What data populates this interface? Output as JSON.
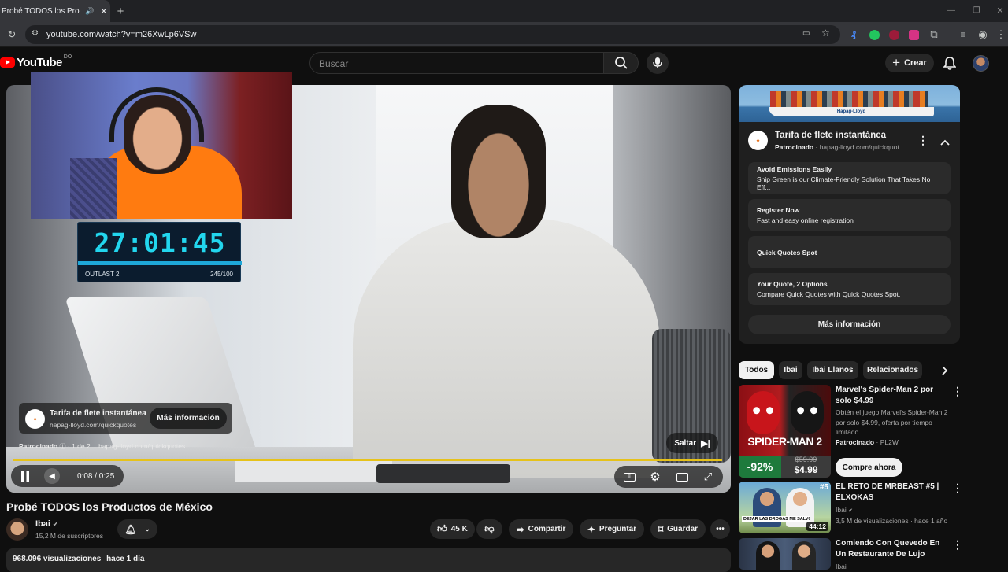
{
  "browser": {
    "tab_title": "Probé TODOS los Producto",
    "url": "youtube.com/watch?v=m26XwLp6VSw"
  },
  "youtube": {
    "logo_text": "YouTube",
    "country_code": "DO",
    "search_placeholder": "Buscar",
    "create_label": "Crear"
  },
  "overlay": {
    "timer": "27:01:45",
    "game": "OUTLAST 2",
    "count": "245/100"
  },
  "player": {
    "ad_title": "Tarifa de flete instantánea",
    "ad_domain": "hapag-lloyd.com/quickquotes",
    "ad_more": "Más información",
    "sponsored": "Patrocinado",
    "ad_counter": "· 1 de 2",
    "ad_domain2": "hapag-lloyd.com/quickquotes",
    "skip": "Saltar",
    "time": "0:08 / 0:25",
    "progress_fraction": 0.32
  },
  "video": {
    "title": "Probé TODOS los Productos de México",
    "channel": "Ibai",
    "subscribers": "15,2 M de suscriptores",
    "likes": "45 K",
    "share": "Compartir",
    "ask": "Preguntar",
    "save": "Guardar",
    "views": "968.096 visualizaciones",
    "age": "hace 1 día"
  },
  "ad_panel": {
    "ship_label": "Hapag-Lloyd",
    "title": "Tarifa de flete instantánea",
    "sponsored": "Patrocinado",
    "domain": "· hapag-lloyd.com/quickquot...",
    "options": [
      {
        "heading": "Avoid Emissions Easily",
        "text": "Ship Green is our Climate-Friendly Solution That Takes No Eff..."
      },
      {
        "heading": "Register Now",
        "text": "Fast and easy online registration"
      },
      {
        "heading": "Quick Quotes Spot",
        "text": ""
      },
      {
        "heading": "Your Quote, 2 Options",
        "text": "Compare Quick Quotes with Quick Quotes Spot."
      }
    ],
    "more": "Más información"
  },
  "chips": [
    "Todos",
    "Ibai",
    "Ibai Llanos",
    "Relacionados"
  ],
  "recommendations": [
    {
      "title": "Marvel's Spider-Man 2 por solo $4.99",
      "desc": "Obtén el juego Marvel's Spider-Man 2 por solo $4.99, oferta por tiempo limitado",
      "sponsor": "Patrocinado",
      "sponsor_meta": "· PL2W",
      "cta": "Compre ahora",
      "thumb_title": "SPIDER-MAN 2",
      "discount": "-92%",
      "old_price": "$59.99",
      "price": "$4.99"
    },
    {
      "title": "EL RETO DE MRBEAST #5 | ELXOKAS",
      "channel": "Ibai",
      "meta": "3,5 M de visualizaciones · hace 1 año",
      "duration": "44:12",
      "thumb_badge": "#5",
      "thumb_caption": "DEJAR LAS DROGAS ME SALVÓ"
    },
    {
      "title": "Comiendo Con Quevedo En Un Restaurante De Lujo",
      "channel": "Ibai"
    }
  ]
}
